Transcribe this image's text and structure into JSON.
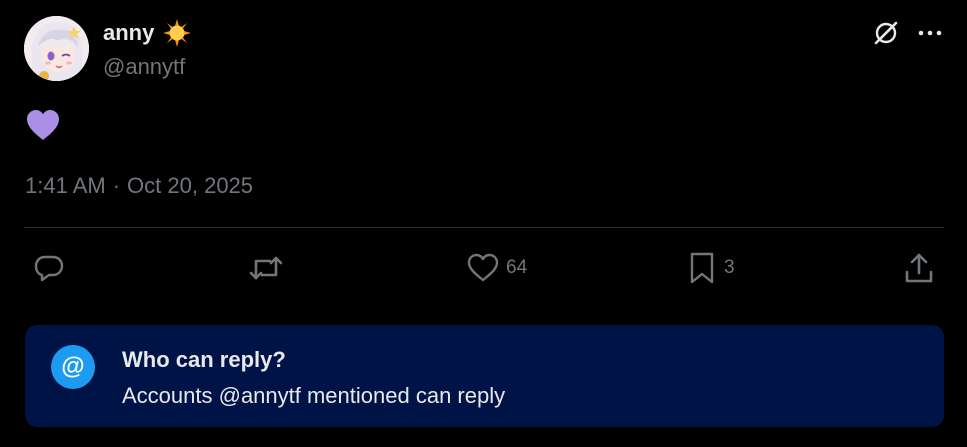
{
  "author": {
    "display_name": "anny",
    "handle": "@annytf",
    "avatar_icon": "avatar-anime-girl",
    "name_emoji": "sun-emoji"
  },
  "post": {
    "content_emoji": "purple-heart-emoji",
    "time": "1:41 AM",
    "separator": "·",
    "date": "Oct 20, 2025"
  },
  "actions": {
    "reply_count": "",
    "repost_count": "",
    "like_count": "64",
    "bookmark_count": "3"
  },
  "reply_restriction": {
    "icon_text": "@",
    "title": "Who can reply?",
    "description": "Accounts @annytf mentioned can reply"
  },
  "colors": {
    "background": "#000000",
    "muted_text": "#71767b",
    "primary_text": "#e7e9ea",
    "reply_box_bg": "#001347",
    "accent_blue": "#1d9bf0",
    "heart_purple": "#ab8ee5"
  }
}
